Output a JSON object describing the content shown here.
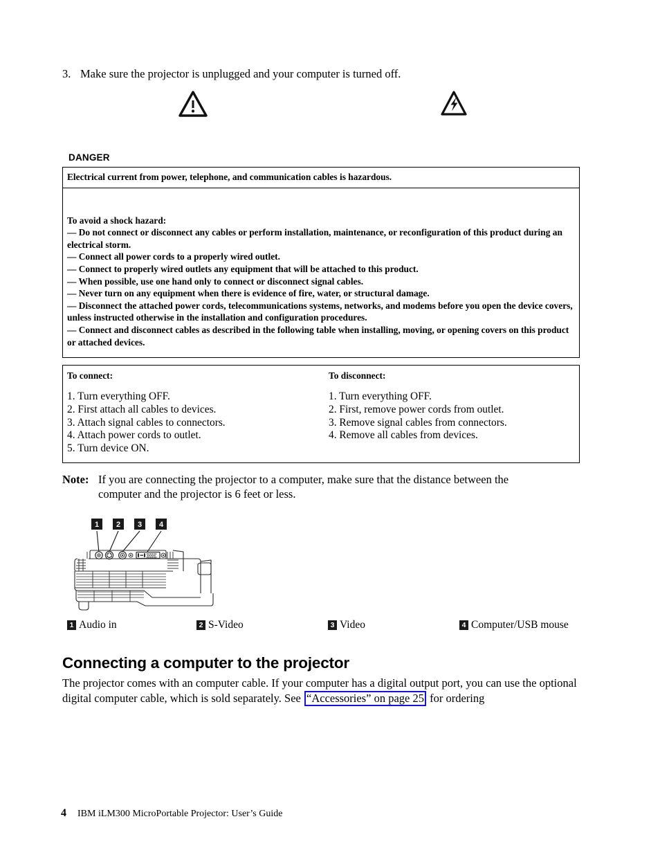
{
  "step": {
    "number": "3.",
    "text": "Make sure the projector is unplugged and your computer is turned off."
  },
  "icons": {
    "caution": "caution-triangle-icon",
    "shock": "electrical-shock-icon"
  },
  "danger": {
    "label": "DANGER",
    "headline": "Electrical current from power, telephone, and communication cables is hazardous.",
    "intro": "To avoid a shock hazard:",
    "bullets": [
      "— Do not connect or disconnect any cables or perform installation, maintenance, or reconfiguration of this product during an electrical storm.",
      "— Connect all power cords to a properly wired outlet.",
      "— Connect to properly wired outlets any equipment that will be attached to this product.",
      "— When possible, use one hand only to connect or disconnect signal cables.",
      "— Never turn on any equipment when there is evidence of fire, water, or structural damage.",
      "— Disconnect the attached power cords, telecommunications systems, networks, and modems before you open the device covers, unless instructed otherwise in the installation and configuration procedures.",
      "— Connect and disconnect cables as described in the following table when installing, moving, or opening covers on this product or attached devices."
    ]
  },
  "connect_table": {
    "connect_header": "To connect:",
    "disconnect_header": "To disconnect:",
    "connect_steps": [
      "1. Turn everything OFF.",
      "2. First attach all cables to devices.",
      "3. Attach signal cables to connectors.",
      "4. Attach power cords to outlet.",
      "5. Turn device ON."
    ],
    "disconnect_steps": [
      "1. Turn everything OFF.",
      "2. First, remove power cords from outlet.",
      "3. Remove signal cables from connectors.",
      "4. Remove all cables from devices."
    ]
  },
  "note": {
    "label": "Note:",
    "line1": "If you are connecting the projector to a computer, make sure that the distance between the",
    "line2": "computer and the projector is 6 feet or less."
  },
  "figure": {
    "name": "projector-side-view-diagram",
    "callouts": [
      "1",
      "2",
      "3",
      "4"
    ]
  },
  "legend": [
    {
      "num": "1",
      "label": "Audio in"
    },
    {
      "num": "2",
      "label": "S-Video"
    },
    {
      "num": "3",
      "label": "Video"
    },
    {
      "num": "4",
      "label": "Computer/USB mouse"
    }
  ],
  "section": {
    "heading": "Connecting a computer to the projector",
    "para_before": "The projector comes with an computer cable. If your computer has a digital output port, you can use the optional digital computer cable, which is sold separately. See ",
    "link_text": "“Accessories” on page 25",
    "para_after": " for ordering"
  },
  "footer": {
    "page_number": "4",
    "text": "IBM iLM300 MicroPortable Projector:  User’s Guide"
  },
  "colors": {
    "link_border": "#1414d2",
    "text": "#000000",
    "callout_bg": "#1a1a1a"
  }
}
